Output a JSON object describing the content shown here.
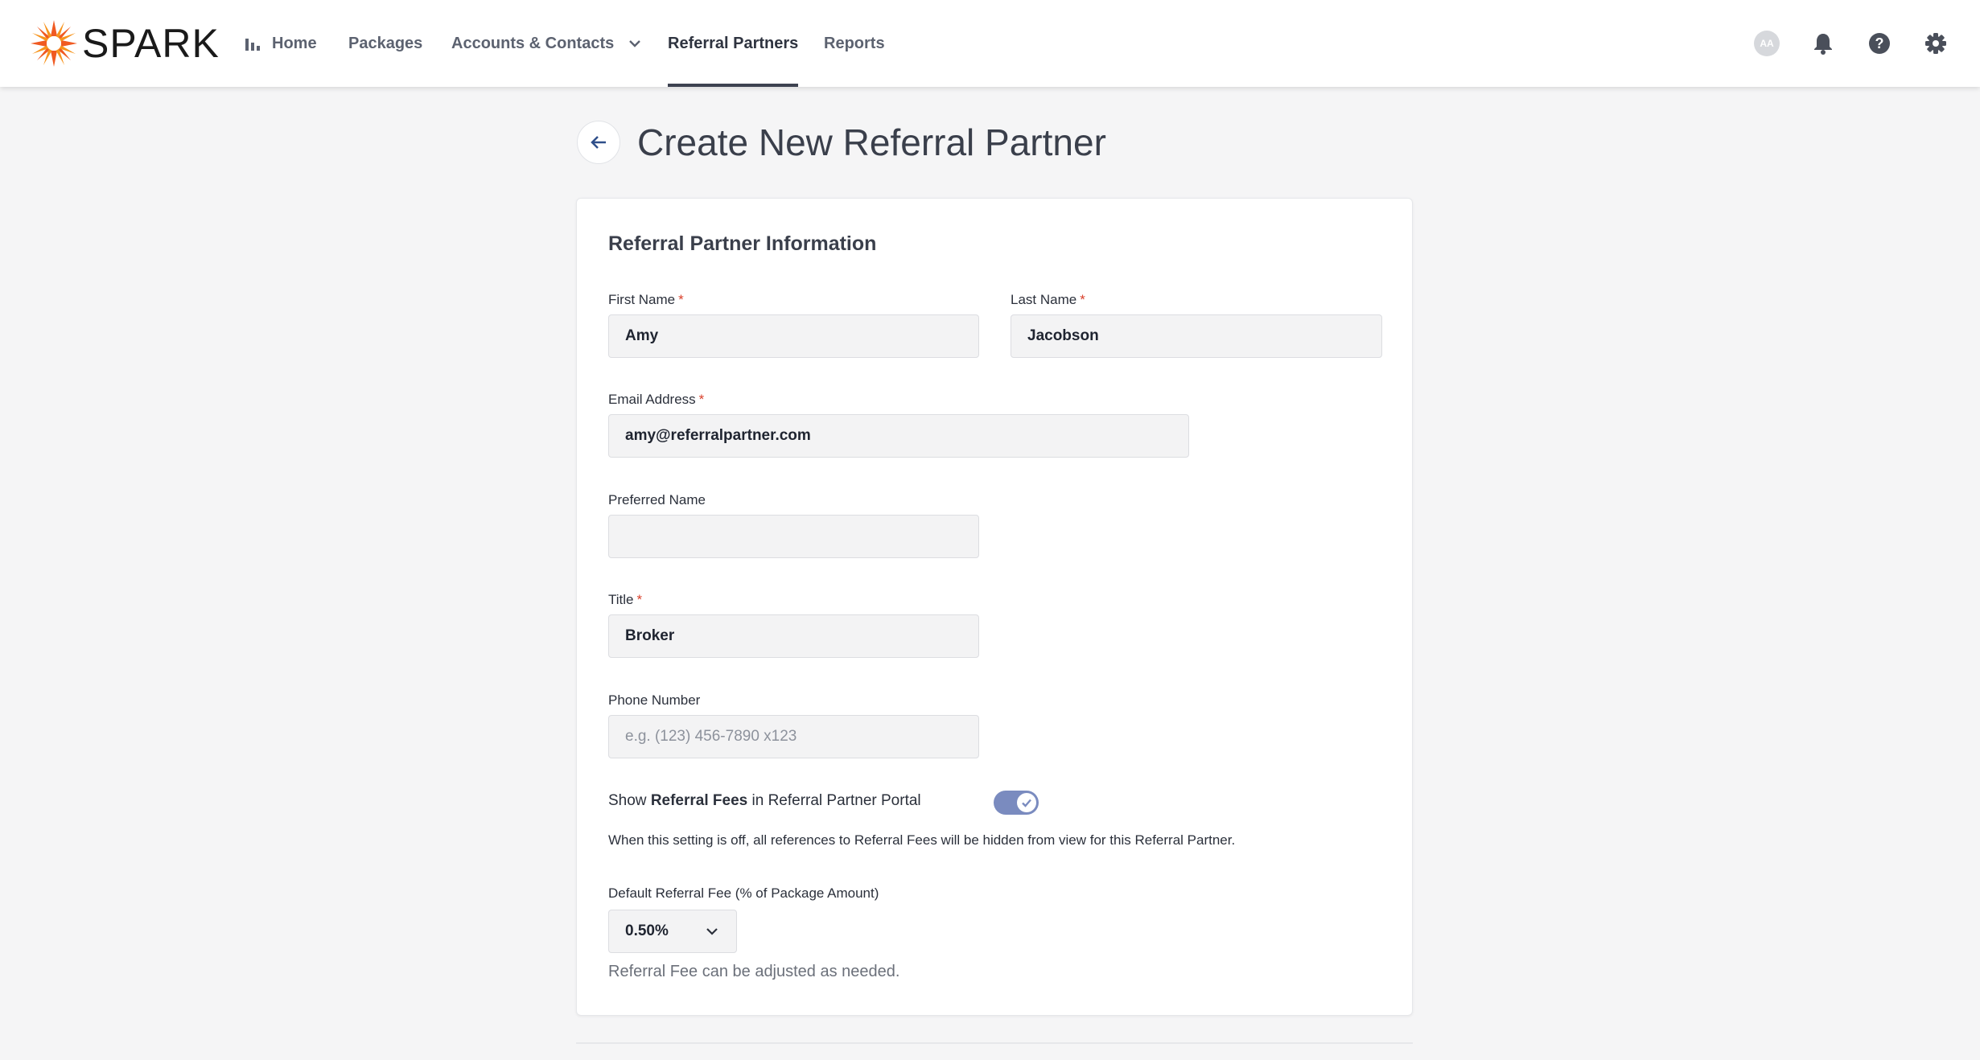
{
  "brand": {
    "name": "SPARK",
    "accent": "#f05a22"
  },
  "nav": {
    "items": [
      {
        "label": "Home",
        "icon": "bar-chart-icon"
      },
      {
        "label": "Packages"
      },
      {
        "label": "Accounts & Contacts",
        "icon": "chevron-down-icon"
      },
      {
        "label": "Referral Partners",
        "active": true
      },
      {
        "label": "Reports"
      }
    ]
  },
  "user": {
    "initials": "AA"
  },
  "header": {
    "title": "Create New Referral Partner"
  },
  "form": {
    "section_title": "Referral Partner Information",
    "required_mark": "*",
    "first_name": {
      "label": "First Name",
      "value": "Amy"
    },
    "last_name": {
      "label": "Last Name",
      "value": "Jacobson"
    },
    "email": {
      "label": "Email Address",
      "value": "amy@referralpartner.com"
    },
    "preferred_name": {
      "label": "Preferred Name",
      "value": ""
    },
    "title": {
      "label": "Title",
      "value": "Broker"
    },
    "phone": {
      "label": "Phone Number",
      "value": "",
      "placeholder": "e.g. (123) 456-7890 x123"
    },
    "toggle": {
      "prefix": "Show ",
      "bold": "Referral Fees",
      "suffix": " in Referral Partner Portal",
      "on": true,
      "help": "When this setting is off, all references to Referral Fees will be hidden from view for this Referral Partner."
    },
    "default_fee": {
      "label": "Default Referral Fee (% of Package Amount)",
      "value": "0.50%",
      "note": "Referral Fee can be adjusted as needed."
    }
  }
}
